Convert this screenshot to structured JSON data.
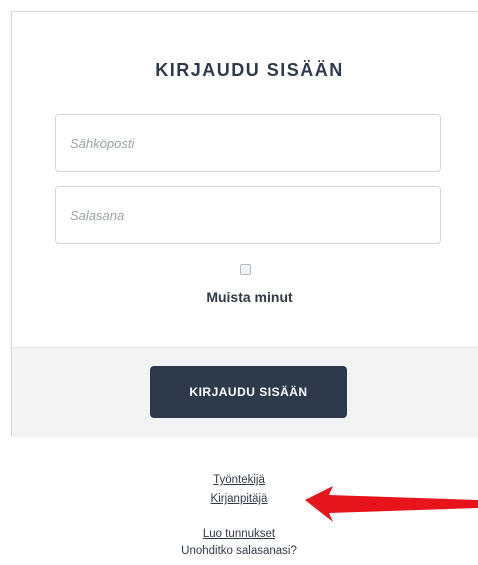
{
  "login": {
    "title": "KIRJAUDU SISÄÄN",
    "email_placeholder": "Sähköposti",
    "password_placeholder": "Salasana",
    "remember_label": "Muista minut",
    "submit_label": "KIRJAUDU SISÄÄN"
  },
  "links": {
    "employee": "Työntekijä",
    "bookkeeper": "Kirjanpitäjä",
    "create_account": "Luo tunnukset",
    "forgot_password": "Unohditko salasanasi?"
  },
  "colors": {
    "primary_button": "#2d3a4b",
    "annotation_arrow": "#e8141b",
    "footer_band": "#f2f3f5"
  },
  "icons": {
    "annotation": "red-arrow-icon"
  }
}
